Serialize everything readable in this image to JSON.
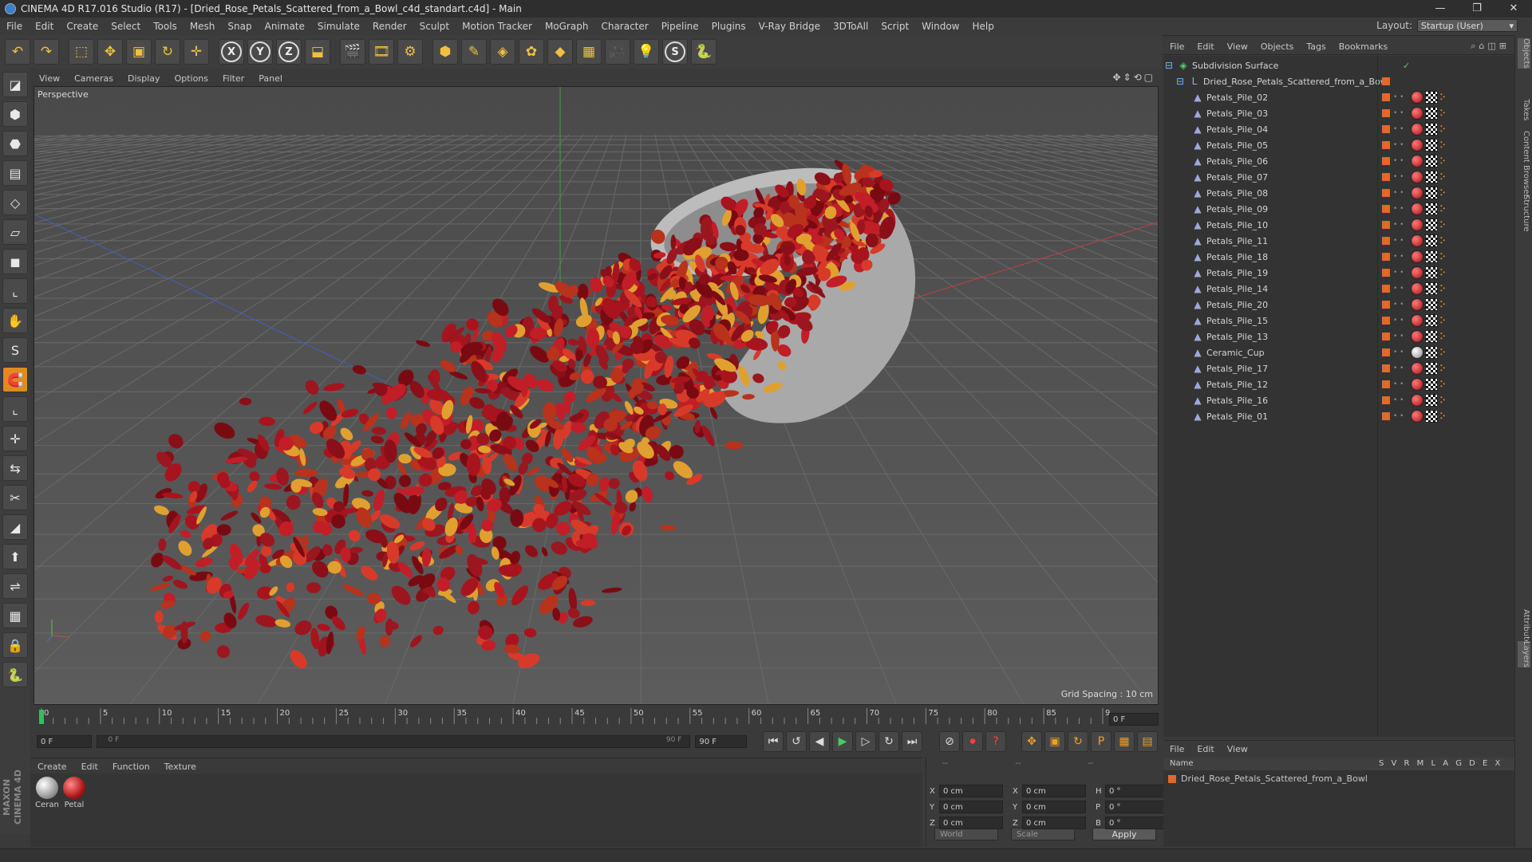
{
  "window": {
    "title": "CINEMA 4D R17.016 Studio (R17) - [Dried_Rose_Petals_Scattered_from_a_Bowl_c4d_standart.c4d] - Main",
    "min": "—",
    "max": "❐",
    "close": "✕"
  },
  "menu": [
    "File",
    "Edit",
    "Create",
    "Select",
    "Tools",
    "Mesh",
    "Snap",
    "Animate",
    "Simulate",
    "Render",
    "Sculpt",
    "Motion Tracker",
    "MoGraph",
    "Character",
    "Pipeline",
    "Plugins",
    "V-Ray Bridge",
    "3DToAll",
    "Script",
    "Window",
    "Help"
  ],
  "layout": {
    "label": "Layout:",
    "value": "Startup (User)"
  },
  "toolbar": [
    {
      "name": "undo-icon",
      "glyph": "↶"
    },
    {
      "name": "redo-icon",
      "glyph": "↷"
    },
    {
      "name": "live-selection-icon",
      "glyph": "⬚"
    },
    {
      "name": "move-icon",
      "glyph": "✥"
    },
    {
      "name": "scale-icon",
      "glyph": "▣"
    },
    {
      "name": "rotate-icon",
      "glyph": "↻"
    },
    {
      "name": "recent-tool-icon",
      "glyph": "✛"
    },
    {
      "name": "x-axis-icon",
      "glyph": "X"
    },
    {
      "name": "y-axis-icon",
      "glyph": "Y"
    },
    {
      "name": "z-axis-icon",
      "glyph": "Z"
    },
    {
      "name": "coordinate-system-icon",
      "glyph": "⬓"
    },
    {
      "name": "render-view-icon",
      "glyph": "🎬"
    },
    {
      "name": "render-picture-viewer-icon",
      "glyph": "🎞"
    },
    {
      "name": "edit-render-settings-icon",
      "glyph": "⚙"
    },
    {
      "name": "cube-icon",
      "glyph": "⬢"
    },
    {
      "name": "spline-pen-icon",
      "glyph": "✎"
    },
    {
      "name": "subdivision-surface-icon",
      "glyph": "◈"
    },
    {
      "name": "cloner-icon",
      "glyph": "✿"
    },
    {
      "name": "deformer-icon",
      "glyph": "◆"
    },
    {
      "name": "floor-icon",
      "glyph": "▦"
    },
    {
      "name": "camera-icon",
      "glyph": "🎥"
    },
    {
      "name": "light-icon",
      "glyph": "💡"
    },
    {
      "name": "spline-icon",
      "glyph": "S"
    },
    {
      "name": "python-icon",
      "glyph": "🐍"
    }
  ],
  "left_tools": [
    "make-editable-icon",
    "model-mode-icon",
    "texture-mode-icon",
    "workplane-icon",
    "points-mode-icon",
    "edges-mode-icon",
    "polygons-mode-icon",
    "axis-mode-icon",
    "tweak-icon",
    "snap-icon",
    "magnet-icon",
    "l-tool-icon",
    "align-icon",
    "transfer-icon",
    "knife-icon",
    "bevel-icon",
    "extrude-icon",
    "bridge-icon",
    "grid-snap-icon",
    "lock-icon",
    "python-left-icon"
  ],
  "left_glyphs": [
    "◪",
    "⬢",
    "⬣",
    "▤",
    "◇",
    "▱",
    "◼",
    "⌞",
    "✋",
    "S",
    "🧲",
    "⌞",
    "✛",
    "⇆",
    "✂",
    "◢",
    "⬆",
    "⇌",
    "▦",
    "🔒",
    "🐍"
  ],
  "maxon_logo": "MAXON CINEMA 4D",
  "viewport": {
    "menu": [
      "View",
      "Cameras",
      "Display",
      "Options",
      "Filter",
      "Panel"
    ],
    "nav_icons": "✥⇕⟲▢",
    "label": "Perspective",
    "grid_spacing": "Grid Spacing : 10 cm"
  },
  "timeline": {
    "ticks": [
      "0",
      "5",
      "10",
      "15",
      "20",
      "25",
      "30",
      "35",
      "40",
      "45",
      "50",
      "55",
      "60",
      "65",
      "70",
      "75",
      "80",
      "85",
      "90"
    ],
    "current_frame_field": "0 F",
    "start_field": "0 F",
    "min_field": "0 F",
    "max_field": "90 F",
    "end_field": "90 F",
    "playhead_frame": 0,
    "max_frame": 90
  },
  "transport": [
    {
      "name": "go-to-start-icon",
      "glyph": "⏮"
    },
    {
      "name": "go-to-previous-key-icon",
      "glyph": "↺"
    },
    {
      "name": "step-back-icon",
      "glyph": "◀"
    },
    {
      "name": "play-icon",
      "glyph": "▶"
    },
    {
      "name": "step-forward-icon",
      "glyph": "▷"
    },
    {
      "name": "go-to-next-key-icon",
      "glyph": "↻"
    },
    {
      "name": "go-to-end-icon",
      "glyph": "⏭"
    },
    {
      "name": "motion-record-icon",
      "glyph": "⊘"
    },
    {
      "name": "record-icon",
      "glyph": "⏺"
    },
    {
      "name": "autokey-icon",
      "glyph": "?"
    },
    {
      "name": "key-position-icon",
      "glyph": "✥"
    },
    {
      "name": "key-scale-icon",
      "glyph": "▣"
    },
    {
      "name": "key-rotation-icon",
      "glyph": "↻"
    },
    {
      "name": "key-param-icon",
      "glyph": "P"
    },
    {
      "name": "key-pla-icon",
      "glyph": "▦"
    },
    {
      "name": "timeline-layout-icon",
      "glyph": "▤"
    }
  ],
  "materials": {
    "menu": [
      "Create",
      "Edit",
      "Function",
      "Texture"
    ],
    "items": [
      {
        "label": "Ceran",
        "color": "radial-gradient(circle at 35% 35%, #ffffff, #8a8a8a 70%, #444)"
      },
      {
        "label": "Petal",
        "color": "radial-gradient(circle at 35% 35%, #ff8a8a, #b01818 60%, #4a0606)"
      }
    ]
  },
  "coordinates": {
    "header": [
      "--",
      "--",
      "--"
    ],
    "rows": [
      {
        "a": "X",
        "av": "0 cm",
        "b": "X",
        "bv": "0 cm",
        "c": "H",
        "cv": "0 °"
      },
      {
        "a": "Y",
        "av": "0 cm",
        "b": "Y",
        "bv": "0 cm",
        "c": "P",
        "cv": "0 °"
      },
      {
        "a": "Z",
        "av": "0 cm",
        "b": "Z",
        "bv": "0 cm",
        "c": "B",
        "cv": "0 °"
      }
    ],
    "mode": "World",
    "type": "Scale",
    "apply": "Apply"
  },
  "objects": {
    "menu": [
      "File",
      "Edit",
      "View",
      "Objects",
      "Tags",
      "Bookmarks"
    ],
    "icons": "⌕⌂◫⊞",
    "root": "Subdivision Surface",
    "group": "Dried_Rose_Petals_Scattered_from_a_Bowl",
    "items": [
      "Petals_Pile_02",
      "Petals_Pile_03",
      "Petals_Pile_04",
      "Petals_Pile_05",
      "Petals_Pile_06",
      "Petals_Pile_07",
      "Petals_Pile_08",
      "Petals_Pile_09",
      "Petals_Pile_10",
      "Petals_Pile_11",
      "Petals_Pile_18",
      "Petals_Pile_19",
      "Petals_Pile_14",
      "Petals_Pile_20",
      "Petals_Pile_15",
      "Petals_Pile_13",
      "Ceramic_Cup",
      "Petals_Pile_17",
      "Petals_Pile_12",
      "Petals_Pile_16",
      "Petals_Pile_01"
    ]
  },
  "right_tabs": [
    "Objects",
    "Takes",
    "Content Browser",
    "Structure",
    "Attributes",
    "Layers"
  ],
  "layers": {
    "menu": [
      "File",
      "Edit",
      "View"
    ],
    "columns": {
      "name": "Name",
      "flags": "S V R M L A G D E X"
    },
    "row": "Dried_Rose_Petals_Scattered_from_a_Bowl"
  }
}
